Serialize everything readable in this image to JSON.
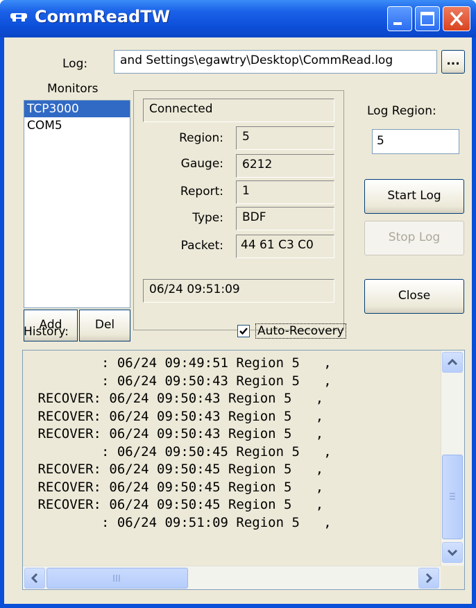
{
  "window": {
    "title": "CommReadTW"
  },
  "log": {
    "label": "Log:",
    "path": "and Settings\\egawtry\\Desktop\\CommRead.log",
    "browse_label": "..."
  },
  "monitors": {
    "label": "Monitors",
    "items": [
      "TCP3000",
      "COM5"
    ],
    "selected": "TCP3000",
    "add_label": "Add",
    "del_label": "Del"
  },
  "status": {
    "connection": "Connected",
    "fields": [
      {
        "label": "Region:",
        "value": "5"
      },
      {
        "label": "Gauge:",
        "value": "6212"
      },
      {
        "label": "Report:",
        "value": "1"
      },
      {
        "label": "Type:",
        "value": "BDF"
      },
      {
        "label": "Packet:",
        "value": "44 61 C3 C0"
      }
    ],
    "timestamp": "06/24 09:51:09"
  },
  "log_region": {
    "label": "Log Region:",
    "value": "5"
  },
  "buttons": {
    "start_log": "Start Log",
    "stop_log": "Stop Log",
    "close": "Close"
  },
  "history": {
    "label": "History:",
    "auto_recovery_label": "Auto-Recovery",
    "auto_recovery_checked": true,
    "lines": [
      "         : 06/24 09:49:51 Region 5   ,",
      "         : 06/24 09:50:43 Region 5   ,",
      " RECOVER: 06/24 09:50:43 Region 5   ,",
      " RECOVER: 06/24 09:50:43 Region 5   ,",
      " RECOVER: 06/24 09:50:43 Region 5   ,",
      "         : 06/24 09:50:45 Region 5   ,",
      " RECOVER: 06/24 09:50:45 Region 5   ,",
      " RECOVER: 06/24 09:50:45 Region 5   ,",
      " RECOVER: 06/24 09:50:45 Region 5   ,",
      "         : 06/24 09:51:09 Region 5   ,"
    ]
  },
  "colors": {
    "titlebar": "#0b46c7",
    "selection": "#316ac5",
    "face": "#ece9d8"
  }
}
